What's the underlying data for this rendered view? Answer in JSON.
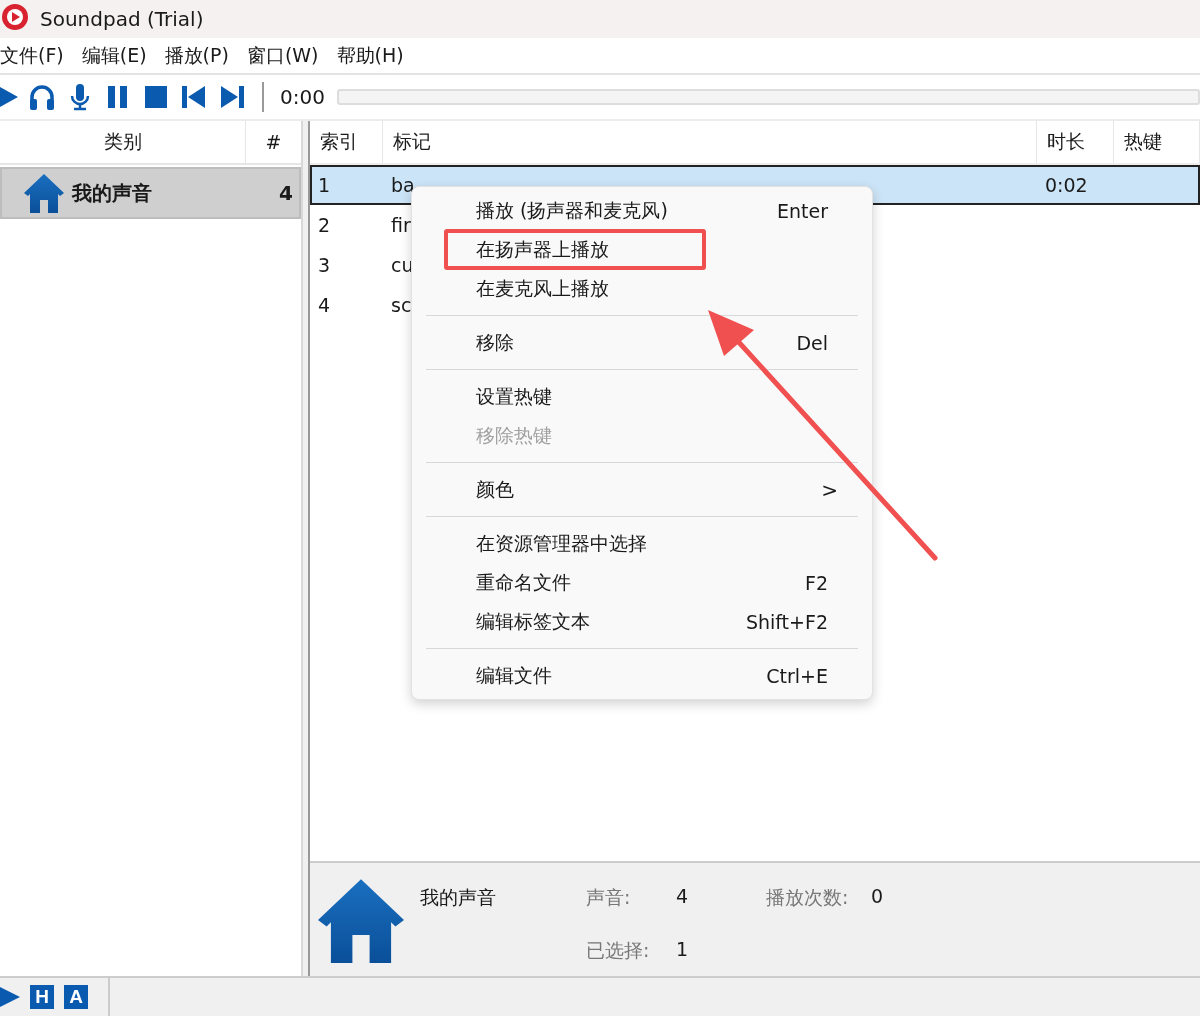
{
  "window": {
    "title": "Soundpad (Trial)"
  },
  "menubar": [
    "文件(F)",
    "编辑(E)",
    "播放(P)",
    "窗口(W)",
    "帮助(H)"
  ],
  "toolbar": {
    "time": "0:00",
    "level": 0
  },
  "categories": {
    "columns": [
      "类别",
      "#"
    ],
    "items": [
      {
        "name": "我的声音",
        "count": "4",
        "selected": true
      }
    ]
  },
  "table": {
    "columns": [
      "索引",
      "标记",
      "时长",
      "热键"
    ],
    "rows": [
      {
        "index": "1",
        "label": "ba",
        "duration": "0:02",
        "selected": true
      },
      {
        "index": "2",
        "label": "fir",
        "selected": false
      },
      {
        "index": "3",
        "label": "cu",
        "selected": false
      },
      {
        "index": "4",
        "label": "sc",
        "selected": false
      }
    ]
  },
  "context_menu": [
    {
      "kind": "item",
      "label": "播放 (扬声器和麦克风)",
      "shortcut": "Enter",
      "disabled": false,
      "annotated": false
    },
    {
      "kind": "item",
      "label": "在扬声器上播放",
      "disabled": false,
      "annotated": true
    },
    {
      "kind": "item",
      "label": "在麦克风上播放",
      "disabled": false,
      "annotated": false
    },
    {
      "kind": "separator"
    },
    {
      "kind": "item",
      "label": "移除",
      "shortcut": "Del",
      "disabled": false,
      "annotated": false
    },
    {
      "kind": "separator"
    },
    {
      "kind": "item",
      "label": "设置热键",
      "disabled": false,
      "annotated": false
    },
    {
      "kind": "item",
      "label": "移除热键",
      "disabled": true,
      "annotated": false
    },
    {
      "kind": "separator"
    },
    {
      "kind": "item",
      "label": "颜色",
      "submenu": ">",
      "disabled": false,
      "annotated": false
    },
    {
      "kind": "separator"
    },
    {
      "kind": "item",
      "label": "在资源管理器中选择",
      "disabled": false,
      "annotated": false
    },
    {
      "kind": "item",
      "label": "重命名文件",
      "shortcut": "F2",
      "disabled": false,
      "annotated": false
    },
    {
      "kind": "item",
      "label": "编辑标签文本",
      "shortcut": "Shift+F2",
      "disabled": false,
      "annotated": false
    },
    {
      "kind": "separator"
    },
    {
      "kind": "item",
      "label": "编辑文件",
      "shortcut": "Ctrl+E",
      "disabled": false,
      "annotated": false
    }
  ],
  "info": {
    "name": "我的声音",
    "stats": [
      {
        "label": "声音:",
        "value": "4"
      },
      {
        "label": "播放次数:",
        "value": "0"
      },
      {
        "label": "已选择:",
        "value": "1"
      }
    ]
  },
  "status_bar": {
    "buttons": [
      "H",
      "A"
    ]
  }
}
